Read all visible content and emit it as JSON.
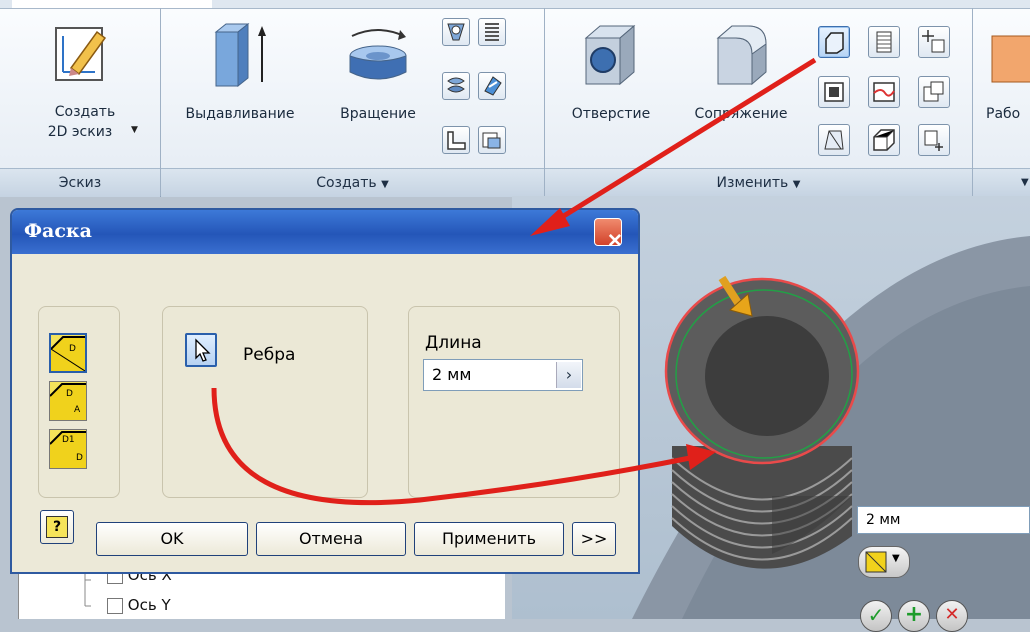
{
  "ribbon": {
    "sketch": {
      "create_line1": "Создать",
      "create_line2": "2D эскиз",
      "group": "Эскиз"
    },
    "create": {
      "extrude": "Выдавливание",
      "revolve": "Вращение",
      "group": "Создать"
    },
    "modify": {
      "hole": "Отверстие",
      "fillet": "Сопряжение",
      "group": "Изменить"
    },
    "work": {
      "label": "Рабо"
    }
  },
  "dialog": {
    "title": "Фаска",
    "edges_label": "Ребра",
    "length_label": "Длина",
    "length_value": "2 мм",
    "ok": "OK",
    "cancel": "Отмена",
    "apply": "Применить",
    "more": ">>",
    "help": "?"
  },
  "viewport": {
    "mini_value": "2 мм"
  },
  "tree": {
    "item1": "Ось X",
    "item2": "Ось Y"
  },
  "colors": {
    "accent_arrow": "#e0201a",
    "title_bar": "#2456b8"
  }
}
